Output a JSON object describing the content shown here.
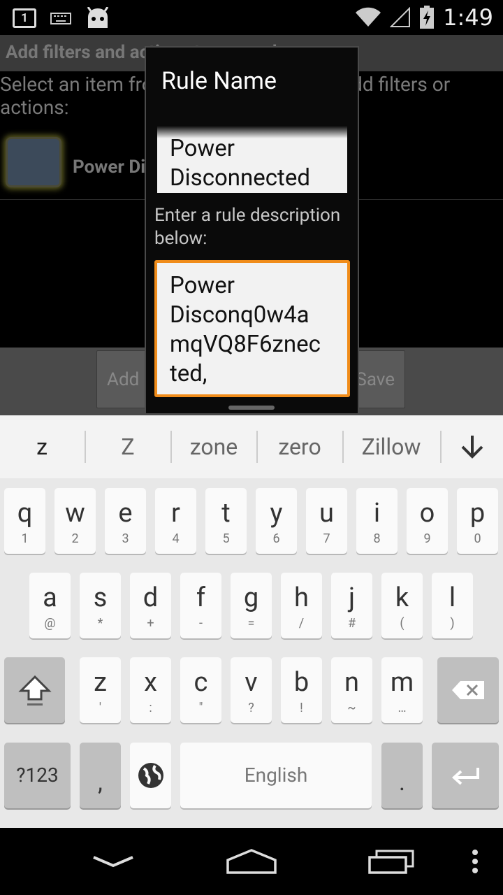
{
  "status_bar": {
    "notification_count": "1",
    "time": "1:49"
  },
  "background": {
    "header": "Add filters and actions to your rule",
    "instruction": "Select an item from the list below, then add filters or actions:",
    "item_label": "Power Disconnected",
    "add_button_label": "Add",
    "save_button_label": "Save"
  },
  "dialog": {
    "title": "Rule Name",
    "name_value": "Power\nDisconnected",
    "description_label": "Enter a rule description below:",
    "description_value": "Power\nDisconq0w4a\nmqVQ8F6znec\nted,"
  },
  "keyboard": {
    "suggestions": [
      "z",
      "Z",
      "zone",
      "zero",
      "Zillow"
    ],
    "row1": [
      [
        "q",
        "1"
      ],
      [
        "w",
        "2"
      ],
      [
        "e",
        "3"
      ],
      [
        "r",
        "4"
      ],
      [
        "t",
        "5"
      ],
      [
        "y",
        "6"
      ],
      [
        "u",
        "7"
      ],
      [
        "i",
        "8"
      ],
      [
        "o",
        "9"
      ],
      [
        "p",
        "0"
      ]
    ],
    "row2": [
      [
        "a",
        "@"
      ],
      [
        "s",
        "*"
      ],
      [
        "d",
        "+"
      ],
      [
        "f",
        "-"
      ],
      [
        "g",
        "="
      ],
      [
        "h",
        "/"
      ],
      [
        "j",
        "#"
      ],
      [
        "k",
        "("
      ],
      [
        "l",
        ")"
      ]
    ],
    "row3": [
      [
        "z",
        "'"
      ],
      [
        "x",
        ":"
      ],
      [
        "c",
        "\""
      ],
      [
        "v",
        "?"
      ],
      [
        "b",
        "!"
      ],
      [
        "n",
        "~"
      ],
      [
        "m",
        "…"
      ]
    ],
    "symbols_label": "?123",
    "comma_label": ",",
    "space_label": "English",
    "period_label": "."
  },
  "colors": {
    "focus_border": "#f08c1a",
    "dialog_bg": "#0a0a0a",
    "keyboard_bg": "#e8e8e8"
  }
}
